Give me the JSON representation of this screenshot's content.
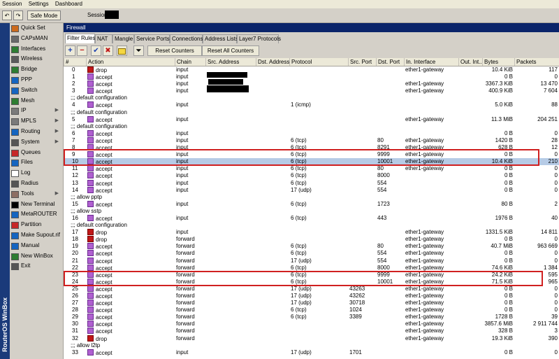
{
  "menu": [
    "Session",
    "Settings",
    "Dashboard"
  ],
  "toolbar": {
    "undo_icon": "undo-icon",
    "redo_icon": "redo-icon",
    "safe_mode_label": "Safe Mode",
    "session_label": "Session:"
  },
  "sidebar_text": "RouterOS WinBox",
  "nav": [
    {
      "label": "Quick Set",
      "icon": "quick-set-icon",
      "color": "#cc6a1c",
      "arrow": false
    },
    {
      "label": "CAPsMAN",
      "icon": "capsman-icon",
      "color": "#6a6a6a",
      "arrow": false
    },
    {
      "label": "Interfaces",
      "icon": "interfaces-icon",
      "color": "#2e7d32",
      "arrow": false
    },
    {
      "label": "Wireless",
      "icon": "wireless-icon",
      "color": "#5b5b5b",
      "arrow": false
    },
    {
      "label": "Bridge",
      "icon": "bridge-icon",
      "color": "#2e7d32",
      "arrow": false
    },
    {
      "label": "PPP",
      "icon": "ppp-icon",
      "color": "#1565c0",
      "arrow": false
    },
    {
      "label": "Switch",
      "icon": "switch-icon",
      "color": "#1565c0",
      "arrow": false
    },
    {
      "label": "Mesh",
      "icon": "mesh-icon",
      "color": "#2e7d32",
      "arrow": false
    },
    {
      "label": "IP",
      "icon": "ip-icon",
      "color": "#7a7a7a",
      "arrow": true
    },
    {
      "label": "MPLS",
      "icon": "mpls-icon",
      "color": "#7a7a7a",
      "arrow": true
    },
    {
      "label": "Routing",
      "icon": "routing-icon",
      "color": "#1565c0",
      "arrow": true
    },
    {
      "label": "System",
      "icon": "system-icon",
      "color": "#555555",
      "arrow": true
    },
    {
      "label": "Queues",
      "icon": "queues-icon",
      "color": "#c62828",
      "arrow": false
    },
    {
      "label": "Files",
      "icon": "files-icon",
      "color": "#1565c0",
      "arrow": false
    },
    {
      "label": "Log",
      "icon": "log-icon",
      "color": "#ffffff",
      "arrow": false
    },
    {
      "label": "Radius",
      "icon": "radius-icon",
      "color": "#555555",
      "arrow": false
    },
    {
      "label": "Tools",
      "icon": "tools-icon",
      "color": "#8d6e63",
      "arrow": true
    },
    {
      "label": "New Terminal",
      "icon": "terminal-icon",
      "color": "#000000",
      "arrow": false
    },
    {
      "label": "MetaROUTER",
      "icon": "metarouter-icon",
      "color": "#1565c0",
      "arrow": false
    },
    {
      "label": "Partition",
      "icon": "partition-icon",
      "color": "#c62828",
      "arrow": false
    },
    {
      "label": "Make Supout.rif",
      "icon": "supout-icon",
      "color": "#1565c0",
      "arrow": false
    },
    {
      "label": "Manual",
      "icon": "manual-icon",
      "color": "#1565c0",
      "arrow": false
    },
    {
      "label": "New WinBox",
      "icon": "winbox-icon",
      "color": "#2e7d32",
      "arrow": false
    },
    {
      "label": "Exit",
      "icon": "exit-icon",
      "color": "#555555",
      "arrow": false
    }
  ],
  "window_title": "Firewall",
  "tabs": [
    "Filter Rules",
    "NAT",
    "Mangle",
    "Service Ports",
    "Connections",
    "Address Lists",
    "Layer7 Protocols"
  ],
  "buttons": {
    "add": "+",
    "remove": "−",
    "enable": "✔",
    "disable": "✖",
    "comment": "",
    "filter": "",
    "reset_counters": "Reset Counters",
    "reset_all_counters": "Reset All Counters"
  },
  "columns": [
    "#",
    "Action",
    "Chain",
    "Src. Address",
    "Dst. Address",
    "Protocol",
    "Src. Port",
    "Dst. Port",
    "In. Interface",
    "Out. Int...",
    "Bytes",
    "Packets"
  ],
  "rows": [
    {
      "id": "0",
      "action": "drop",
      "chain": "input",
      "src": "",
      "dst": "",
      "proto": "",
      "sport": "",
      "dport": "",
      "inif": "ether1-gateway",
      "outif": "",
      "bytes": "10.4 KiB",
      "packets": "117"
    },
    {
      "id": "1",
      "action": "accept",
      "chain": "input",
      "src": "",
      "dst": "",
      "proto": "",
      "sport": "",
      "dport": "",
      "inif": "",
      "outif": "",
      "bytes": "0 B",
      "packets": "0"
    },
    {
      "id": "2",
      "action": "accept",
      "chain": "input",
      "src": "",
      "dst": "",
      "proto": "",
      "sport": "",
      "dport": "",
      "inif": "ether1-gateway",
      "outif": "",
      "bytes": "3367.3 KiB",
      "packets": "13 470"
    },
    {
      "id": "3",
      "action": "accept",
      "chain": "input",
      "src": "",
      "dst": "",
      "proto": "",
      "sport": "",
      "dport": "",
      "inif": "ether1-gateway",
      "outif": "",
      "bytes": "400.9 KiB",
      "packets": "7 604"
    },
    {
      "comment": ";;; default configuration"
    },
    {
      "id": "4",
      "action": "accept",
      "chain": "input",
      "src": "",
      "dst": "",
      "proto": "1 (icmp)",
      "sport": "",
      "dport": "",
      "inif": "",
      "outif": "",
      "bytes": "5.0 KiB",
      "packets": "88"
    },
    {
      "comment": ";;; default configuration"
    },
    {
      "id": "5",
      "action": "accept",
      "chain": "input",
      "src": "",
      "dst": "",
      "proto": "",
      "sport": "",
      "dport": "",
      "inif": "ether1-gateway",
      "outif": "",
      "bytes": "11.3 MiB",
      "packets": "204 251"
    },
    {
      "comment": ";;; default configuration"
    },
    {
      "id": "6",
      "action": "accept",
      "chain": "input",
      "src": "",
      "dst": "",
      "proto": "",
      "sport": "",
      "dport": "",
      "inif": "",
      "outif": "",
      "bytes": "0 B",
      "packets": "0"
    },
    {
      "id": "7",
      "action": "accept",
      "chain": "input",
      "src": "",
      "dst": "",
      "proto": "6 (tcp)",
      "sport": "",
      "dport": "80",
      "inif": "ether1-gateway",
      "outif": "",
      "bytes": "1420 B",
      "packets": "28"
    },
    {
      "id": "8",
      "action": "accept",
      "chain": "input",
      "src": "",
      "dst": "",
      "proto": "6 (tcp)",
      "sport": "",
      "dport": "8291",
      "inif": "ether1-gateway",
      "outif": "",
      "bytes": "628 B",
      "packets": "12"
    },
    {
      "id": "9",
      "action": "accept",
      "chain": "input",
      "src": "",
      "dst": "",
      "proto": "6 (tcp)",
      "sport": "",
      "dport": "9999",
      "inif": "ether1-gateway",
      "outif": "",
      "bytes": "0 B",
      "packets": "0"
    },
    {
      "id": "10",
      "action": "accept",
      "chain": "input",
      "src": "",
      "dst": "",
      "proto": "6 (tcp)",
      "sport": "",
      "dport": "10001",
      "inif": "ether1-gateway",
      "outif": "",
      "bytes": "10.4 KiB",
      "packets": "210",
      "selected": true
    },
    {
      "id": "11",
      "action": "accept",
      "chain": "input",
      "src": "",
      "dst": "",
      "proto": "6 (tcp)",
      "sport": "",
      "dport": "80",
      "inif": "ether1-gateway",
      "outif": "",
      "bytes": "0 B",
      "packets": "0"
    },
    {
      "id": "12",
      "action": "accept",
      "chain": "input",
      "src": "",
      "dst": "",
      "proto": "6 (tcp)",
      "sport": "",
      "dport": "8000",
      "inif": "",
      "outif": "",
      "bytes": "0 B",
      "packets": "0"
    },
    {
      "id": "13",
      "action": "accept",
      "chain": "input",
      "src": "",
      "dst": "",
      "proto": "6 (tcp)",
      "sport": "",
      "dport": "554",
      "inif": "",
      "outif": "",
      "bytes": "0 B",
      "packets": "0"
    },
    {
      "id": "14",
      "action": "accept",
      "chain": "input",
      "src": "",
      "dst": "",
      "proto": "17 (udp)",
      "sport": "",
      "dport": "554",
      "inif": "",
      "outif": "",
      "bytes": "0 B",
      "packets": "0"
    },
    {
      "comment": ";;; allow pptp"
    },
    {
      "id": "15",
      "action": "accept",
      "chain": "input",
      "src": "",
      "dst": "",
      "proto": "6 (tcp)",
      "sport": "",
      "dport": "1723",
      "inif": "",
      "outif": "",
      "bytes": "80 B",
      "packets": "2"
    },
    {
      "comment": ";;; allow sstp"
    },
    {
      "id": "16",
      "action": "accept",
      "chain": "input",
      "src": "",
      "dst": "",
      "proto": "6 (tcp)",
      "sport": "",
      "dport": "443",
      "inif": "",
      "outif": "",
      "bytes": "1976 B",
      "packets": "40"
    },
    {
      "comment": ";;; default configuration"
    },
    {
      "id": "17",
      "action": "drop",
      "chain": "input",
      "src": "",
      "dst": "",
      "proto": "",
      "sport": "",
      "dport": "",
      "inif": "ether1-gateway",
      "outif": "",
      "bytes": "1331.5 KiB",
      "packets": "14 811"
    },
    {
      "id": "18",
      "action": "drop",
      "chain": "forward",
      "src": "",
      "dst": "",
      "proto": "",
      "sport": "",
      "dport": "",
      "inif": "ether1-gateway",
      "outif": "",
      "bytes": "0 B",
      "packets": "0"
    },
    {
      "id": "19",
      "action": "accept",
      "chain": "forward",
      "src": "",
      "dst": "",
      "proto": "6 (tcp)",
      "sport": "",
      "dport": "80",
      "inif": "ether1-gateway",
      "outif": "",
      "bytes": "40.7 MiB",
      "packets": "963 669"
    },
    {
      "id": "20",
      "action": "accept",
      "chain": "forward",
      "src": "",
      "dst": "",
      "proto": "6 (tcp)",
      "sport": "",
      "dport": "554",
      "inif": "ether1-gateway",
      "outif": "",
      "bytes": "0 B",
      "packets": "0"
    },
    {
      "id": "21",
      "action": "accept",
      "chain": "forward",
      "src": "",
      "dst": "",
      "proto": "17 (udp)",
      "sport": "",
      "dport": "554",
      "inif": "ether1-gateway",
      "outif": "",
      "bytes": "0 B",
      "packets": "0"
    },
    {
      "id": "22",
      "action": "accept",
      "chain": "forward",
      "src": "",
      "dst": "",
      "proto": "6 (tcp)",
      "sport": "",
      "dport": "8000",
      "inif": "ether1-gateway",
      "outif": "",
      "bytes": "74.6 KiB",
      "packets": "1 384"
    },
    {
      "id": "23",
      "action": "accept",
      "chain": "forward",
      "src": "",
      "dst": "",
      "proto": "6 (tcp)",
      "sport": "",
      "dport": "9999",
      "inif": "ether1-gateway",
      "outif": "",
      "bytes": "24.2 KiB",
      "packets": "595"
    },
    {
      "id": "24",
      "action": "accept",
      "chain": "forward",
      "src": "",
      "dst": "",
      "proto": "6 (tcp)",
      "sport": "",
      "dport": "10001",
      "inif": "ether1-gateway",
      "outif": "",
      "bytes": "71.5 KiB",
      "packets": "965"
    },
    {
      "id": "25",
      "action": "accept",
      "chain": "forward",
      "src": "",
      "dst": "",
      "proto": "17 (udp)",
      "sport": "43263",
      "dport": "",
      "inif": "ether1-gateway",
      "outif": "",
      "bytes": "0 B",
      "packets": "0"
    },
    {
      "id": "26",
      "action": "accept",
      "chain": "forward",
      "src": "",
      "dst": "",
      "proto": "17 (udp)",
      "sport": "43262",
      "dport": "",
      "inif": "ether1-gateway",
      "outif": "",
      "bytes": "0 B",
      "packets": "0"
    },
    {
      "id": "27",
      "action": "accept",
      "chain": "forward",
      "src": "",
      "dst": "",
      "proto": "17 (udp)",
      "sport": "30718",
      "dport": "",
      "inif": "ether1-gateway",
      "outif": "",
      "bytes": "0 B",
      "packets": "0"
    },
    {
      "id": "28",
      "action": "accept",
      "chain": "forward",
      "src": "",
      "dst": "",
      "proto": "6 (tcp)",
      "sport": "1024",
      "dport": "",
      "inif": "ether1-gateway",
      "outif": "",
      "bytes": "0 B",
      "packets": "0"
    },
    {
      "id": "29",
      "action": "accept",
      "chain": "forward",
      "src": "",
      "dst": "",
      "proto": "6 (tcp)",
      "sport": "3389",
      "dport": "",
      "inif": "ether1-gateway",
      "outif": "",
      "bytes": "1728 B",
      "packets": "39"
    },
    {
      "id": "30",
      "action": "accept",
      "chain": "forward",
      "src": "",
      "dst": "",
      "proto": "",
      "sport": "",
      "dport": "",
      "inif": "ether1-gateway",
      "outif": "",
      "bytes": "3857.6 MiB",
      "packets": "2 911 744"
    },
    {
      "id": "31",
      "action": "accept",
      "chain": "forward",
      "src": "",
      "dst": "",
      "proto": "",
      "sport": "",
      "dport": "",
      "inif": "ether1-gateway",
      "outif": "",
      "bytes": "328 B",
      "packets": "3"
    },
    {
      "id": "32",
      "action": "drop",
      "chain": "forward",
      "src": "",
      "dst": "",
      "proto": "",
      "sport": "",
      "dport": "",
      "inif": "ether1-gateway",
      "outif": "",
      "bytes": "19.3 KiB",
      "packets": "390"
    },
    {
      "comment": ";;; allow l2tp"
    },
    {
      "id": "33",
      "action": "accept",
      "chain": "input",
      "src": "",
      "dst": "",
      "proto": "17 (udp)",
      "sport": "1701",
      "dport": "",
      "inif": "",
      "outif": "",
      "bytes": "0 B",
      "packets": "0"
    }
  ],
  "colors": {
    "accent": "#0a246a",
    "selected_row": "#b6cbe6",
    "highlight_border": "#d02020",
    "drop_icon": "#c01818",
    "accept_icon": "#b060d0"
  }
}
